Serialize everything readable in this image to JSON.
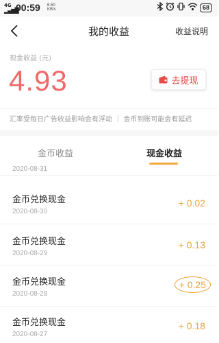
{
  "status_bar": {
    "network": "4G",
    "time": "00:59",
    "speed_value": "6.50",
    "speed_unit": "KB/s",
    "battery": "68"
  },
  "nav": {
    "title": "我的收益",
    "help_label": "收益说明"
  },
  "summary": {
    "balance_label": "现金收益 (元)",
    "balance_value": "4.93",
    "withdraw_label": "去提现"
  },
  "notice": "汇率受每日广告收益影响会有浮动 ｜ 金币到账可能会有延迟",
  "tabs": [
    {
      "label": "金币收益",
      "active": false
    },
    {
      "label": "现金收益",
      "active": true
    }
  ],
  "transactions": {
    "partial_date": "2020-08-31",
    "rows": [
      {
        "title": "金币兑换现金",
        "date": "2020-08-30",
        "amount": "+ 0.02"
      },
      {
        "title": "金币兑换现金",
        "date": "2020-08-29",
        "amount": "+ 0.13"
      },
      {
        "title": "金币兑换现金",
        "date": "2020-08-28",
        "amount": "+ 0.25"
      },
      {
        "title": "金币兑换现金",
        "date": "2020-08-27",
        "amount": "+ 0.18"
      }
    ]
  },
  "colors": {
    "balance": "#f06a6a",
    "accent": "#f5a93a",
    "amount": "#e8a23a",
    "withdraw": "#e84a4a"
  }
}
